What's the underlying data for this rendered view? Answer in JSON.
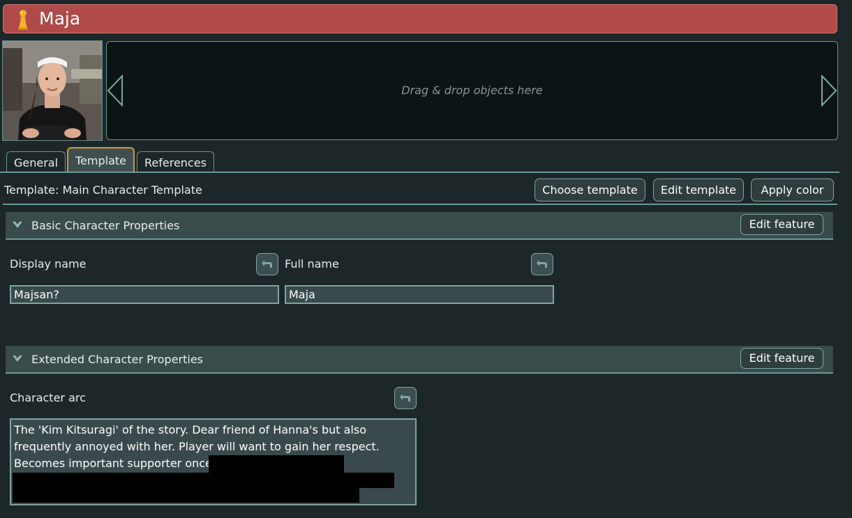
{
  "window": {
    "title": "Maja",
    "title_icon": "pawn-icon"
  },
  "portrait": {
    "alt": "character-portrait"
  },
  "carousel": {
    "hint": "Drag & drop objects here"
  },
  "tabs": [
    {
      "label": "General",
      "active": false
    },
    {
      "label": "Template",
      "active": true
    },
    {
      "label": "References",
      "active": false
    }
  ],
  "template": {
    "label": "Template: Main Character Template",
    "choose_label": "Choose template",
    "edit_label": "Edit template",
    "apply_color_label": "Apply color"
  },
  "sections": [
    {
      "title": "Basic Character Properties",
      "edit_label": "Edit feature",
      "fields": [
        {
          "label": "Display name",
          "value": "Majsan?"
        },
        {
          "label": "Full name",
          "value": "Maja"
        }
      ]
    },
    {
      "title": "Extended Character Properties",
      "edit_label": "Edit feature",
      "fields": [
        {
          "label": "Character arc",
          "lines": [
            "The 'Kim Kitsuragi' of the story. Dear friend of Hanna's but also",
            "frequently annoyed with her. Player will want to gain her respect.",
            "Becomes important supporter once"
          ]
        }
      ]
    }
  ],
  "colors": {
    "titlebar": "#b04a4a",
    "accent": "#6a9a98",
    "active_tab_border": "#d29a3b",
    "background": "#1d2628"
  }
}
